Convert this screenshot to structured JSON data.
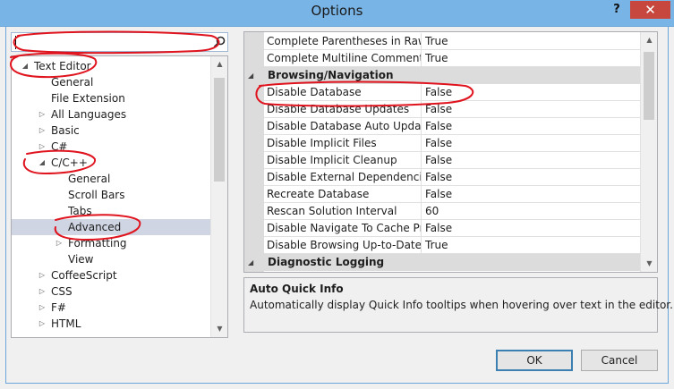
{
  "window": {
    "title": "Options",
    "help_label": "?",
    "close_label": "✕"
  },
  "search": {
    "value": "",
    "placeholder": ""
  },
  "tree": {
    "items": [
      {
        "label": "Text Editor",
        "expanded": true,
        "arrow": "◢"
      },
      {
        "label": "General"
      },
      {
        "label": "File Extension"
      },
      {
        "label": "All Languages",
        "arrow": "▷"
      },
      {
        "label": "Basic",
        "arrow": "▷"
      },
      {
        "label": "C#",
        "arrow": "▷"
      },
      {
        "label": "C/C++",
        "expanded": true,
        "arrow": "◢"
      },
      {
        "label": "General"
      },
      {
        "label": "Scroll Bars"
      },
      {
        "label": "Tabs"
      },
      {
        "label": "Advanced",
        "selected": true
      },
      {
        "label": "Formatting",
        "arrow": "▷"
      },
      {
        "label": "View"
      },
      {
        "label": "CoffeeScript",
        "arrow": "▷"
      },
      {
        "label": "CSS",
        "arrow": "▷"
      },
      {
        "label": "F#",
        "arrow": "▷"
      },
      {
        "label": "HTML",
        "arrow": "▷"
      }
    ],
    "scroll_up": "▲",
    "scroll_down": "▼"
  },
  "grid": {
    "rows": [
      {
        "type": "prop",
        "name": "Complete Parentheses in Raw St",
        "value": "True"
      },
      {
        "type": "prop",
        "name": "Complete Multiline Comments",
        "value": "True"
      },
      {
        "type": "category",
        "name": "Browsing/Navigation",
        "arrow": "◢"
      },
      {
        "type": "prop",
        "name": "Disable Database",
        "value": "False"
      },
      {
        "type": "prop",
        "name": "Disable Database Updates",
        "value": "False"
      },
      {
        "type": "prop",
        "name": "Disable Database Auto Updates",
        "value": "False"
      },
      {
        "type": "prop",
        "name": "Disable Implicit Files",
        "value": "False"
      },
      {
        "type": "prop",
        "name": "Disable Implicit Cleanup",
        "value": "False"
      },
      {
        "type": "prop",
        "name": "Disable External Dependencies Fo",
        "value": "False"
      },
      {
        "type": "prop",
        "name": "Recreate Database",
        "value": "False"
      },
      {
        "type": "prop",
        "name": "Rescan Solution Interval",
        "value": "60"
      },
      {
        "type": "prop",
        "name": "Disable Navigate To Cache Prelo",
        "value": "False"
      },
      {
        "type": "prop",
        "name": "Disable Browsing Up-to-Date Ch",
        "value": "True"
      },
      {
        "type": "category",
        "name": "Diagnostic Logging",
        "arrow": "◢"
      }
    ],
    "scroll_up": "▲",
    "scroll_down": "▼"
  },
  "description": {
    "title": "Auto Quick Info",
    "text": "Automatically display Quick Info tooltips when hovering over text in the editor."
  },
  "buttons": {
    "ok": "OK",
    "cancel": "Cancel"
  },
  "colors": {
    "titlebar": "#78b4e6",
    "close": "#c7473e",
    "selection": "#cfd5e2",
    "annotation": "#e0141e"
  }
}
